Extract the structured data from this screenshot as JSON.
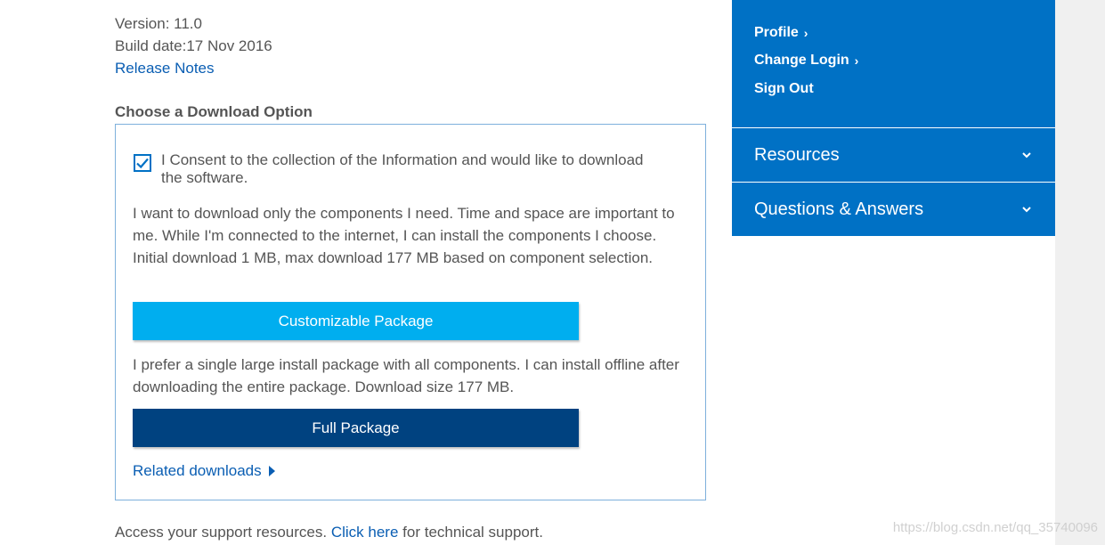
{
  "info": {
    "version": "Version: 11.0",
    "build_date": "Build date:17 Nov 2016",
    "release_notes": "Release Notes"
  },
  "download": {
    "section_title": "Choose a Download Option",
    "consent_text": "I Consent to the collection of the Information and would like to download the software.",
    "consent_checked": true,
    "custom_desc": "I want to download only the components I need. Time and space are important to me. While I'm connected to the internet, I can install the components I choose. Initial download 1 MB, max download 177 MB based on component selection.",
    "custom_button": "Customizable Package",
    "full_desc": "I prefer a single large install package with all components. I can install offline after downloading the entire package. Download size 177 MB.",
    "full_button": "Full Package",
    "related": "Related downloads"
  },
  "footer": {
    "prefix": "Access your support resources.",
    "link": "Click here",
    "suffix": "for technical support."
  },
  "sidebar": {
    "links": [
      {
        "label": "Profile",
        "chevron": "›"
      },
      {
        "label": "Change Login",
        "chevron": "›"
      },
      {
        "label": "Sign Out"
      }
    ],
    "accordions": [
      {
        "label": "Resources"
      },
      {
        "label": "Questions & Answers"
      }
    ]
  },
  "watermark": "https://blog.csdn.net/qq_35740096",
  "colors": {
    "sidebar_blue": "#0071c5",
    "button_light": "#00aeef",
    "button_dark": "#004280",
    "link": "#0a5eb3"
  }
}
